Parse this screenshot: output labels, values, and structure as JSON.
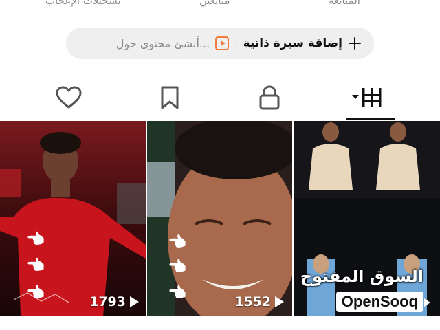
{
  "profile_stats": {
    "likes_label": "تسجيلات الإعجاب",
    "followers_label": "متابعين",
    "following_label": "المتابعة"
  },
  "action_bar": {
    "add_bio_label": "إضافة سيرة ذاتية",
    "separator": "·",
    "create_placeholder": "أنشئ محتوى حول...",
    "accent_color": "#f07b3f"
  },
  "tabs": [
    {
      "name": "videos",
      "icon": "grid-icon",
      "active": true
    },
    {
      "name": "private",
      "icon": "lock-icon",
      "active": false
    },
    {
      "name": "saved",
      "icon": "bookmark-icon",
      "active": false
    },
    {
      "name": "liked",
      "icon": "heart-icon",
      "active": false
    }
  ],
  "videos": [
    {
      "views": "1793"
    },
    {
      "views": "1552"
    },
    {
      "brand_arabic": "السوق المفتوح",
      "brand_latin": "OpenSooq"
    }
  ]
}
